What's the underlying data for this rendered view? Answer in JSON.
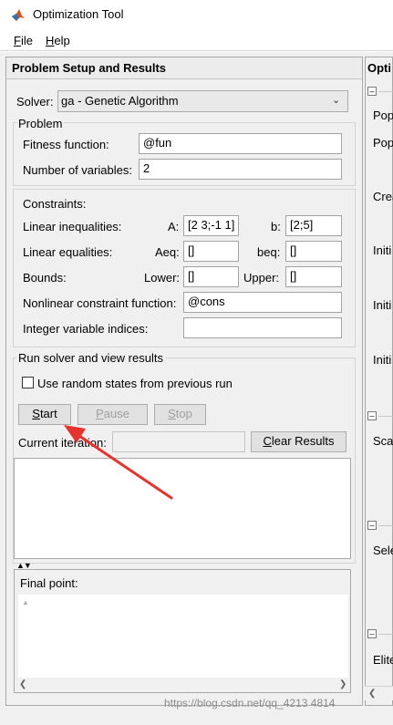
{
  "window": {
    "title": "Optimization Tool"
  },
  "menu": [
    {
      "accel": "F",
      "rest": "ile"
    },
    {
      "accel": "H",
      "rest": "elp"
    }
  ],
  "left_panel": {
    "header": "Problem Setup and Results",
    "solver_label": "Solver:",
    "solver_value": "ga - Genetic Algorithm"
  },
  "problem": {
    "group_title": "Problem",
    "fitness_label": "Fitness function:",
    "fitness_value": "@fun",
    "nvars_label": "Number of variables:",
    "nvars_value": "2"
  },
  "constraints": {
    "title": "Constraints:",
    "lin_ineq_label": "Linear inequalities:",
    "A_label": "A:",
    "A_value": "[2 3;-1 1]",
    "b_label": "b:",
    "b_value": "[2;5]",
    "lin_eq_label": "Linear equalities:",
    "Aeq_label": "Aeq:",
    "Aeq_value": "[]",
    "beq_label": "beq:",
    "beq_value": "[]",
    "bounds_label": "Bounds:",
    "lower_label": "Lower:",
    "lower_value": "[]",
    "upper_label": "Upper:",
    "upper_value": "[]",
    "nonlin_label": "Nonlinear constraint function:",
    "nonlin_value": "@cons",
    "intvars_label": "Integer variable indices:",
    "intvars_value": ""
  },
  "run": {
    "group_title": "Run solver and view results",
    "random_states_label": "Use random states from previous run",
    "random_states_checked": false,
    "start": {
      "accel": "S",
      "rest": "tart"
    },
    "pause": {
      "accel": "P",
      "rest": "ause"
    },
    "stop": {
      "accel": "S",
      "rest": "top"
    },
    "iteration_label": "Current iteration:",
    "iteration_value": "",
    "clear": {
      "accel": "C",
      "rest": "lear Results"
    }
  },
  "final_point_label": "Final point:",
  "right_panel": {
    "header": "Opti",
    "labels": [
      "Pop",
      "Pop",
      "Crea",
      "Initi",
      "Initi",
      "Initi",
      "Scal",
      "Sele",
      "Elite"
    ]
  },
  "watermark": "https://blog.csdn.net/qq_4213 4814",
  "colors": {
    "annotation_arrow": "#e8322e",
    "panel_bg": "#f0f0f0"
  },
  "icons": {
    "app": "matlab-peaks-icon",
    "dropdown": "chevron-down-icon"
  }
}
